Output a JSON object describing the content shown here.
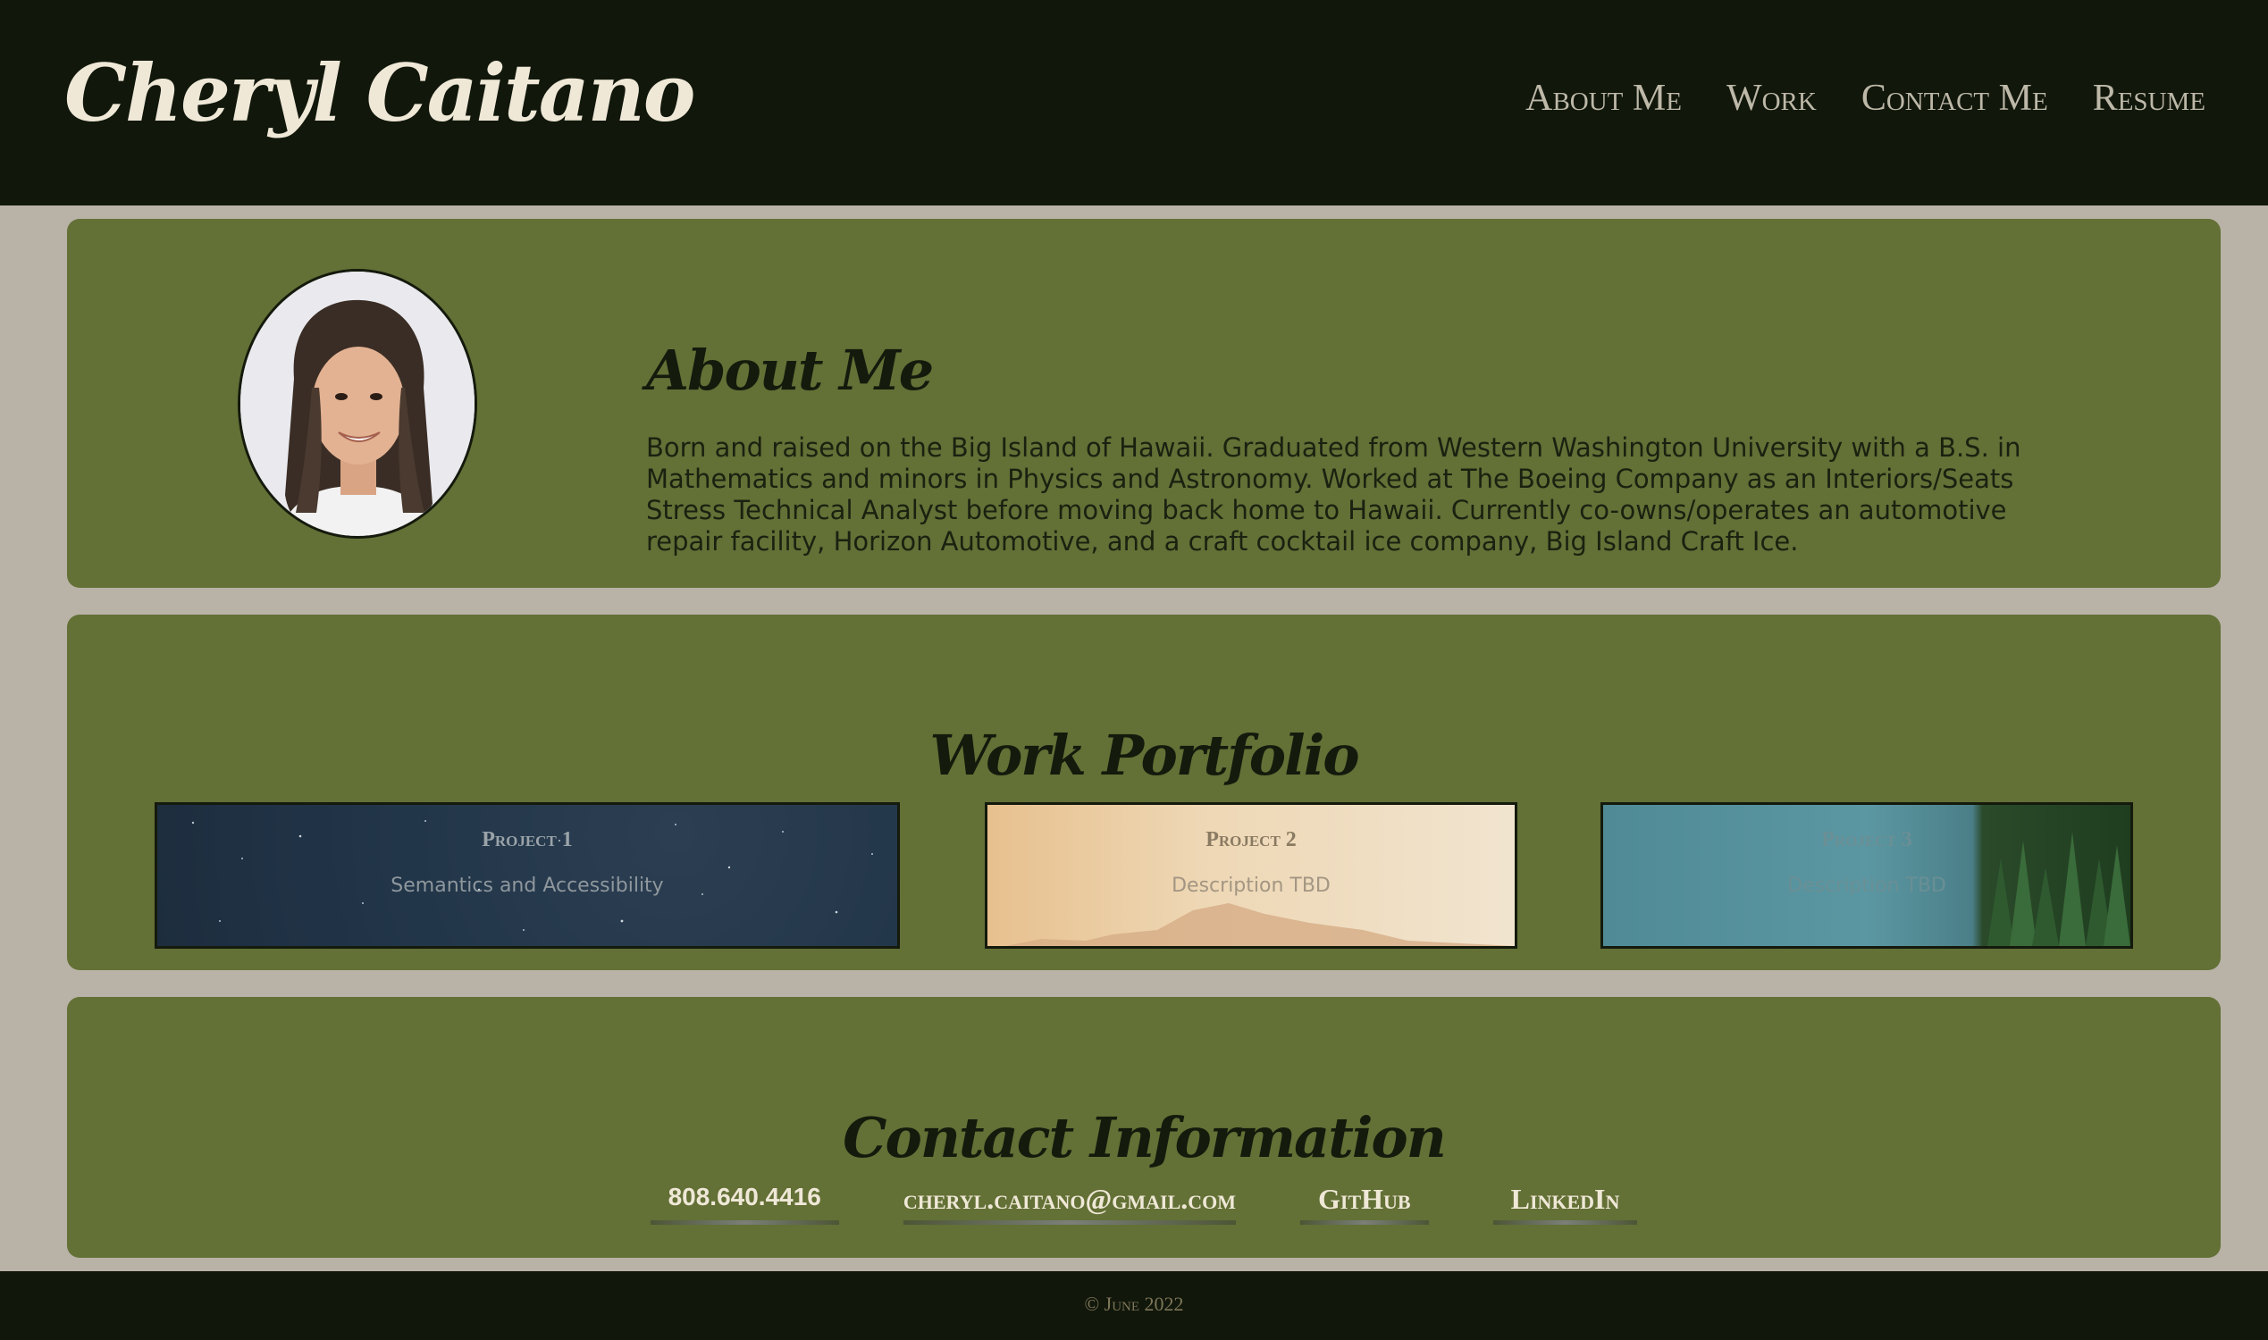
{
  "header": {
    "logo": "Cheryl Caitano",
    "nav": [
      "About Me",
      "Work",
      "Contact Me",
      "Resume"
    ]
  },
  "about": {
    "title": "About Me",
    "text": "Born and raised on the Big Island of Hawaii. Graduated from Western Washington University with a B.S. in Mathematics and minors in Physics and Astronomy. Worked at The Boeing Company as an Interiors/Seats Stress Technical Analyst before moving back home to Hawaii. Currently co-owns/operates an automotive repair facility, Horizon Automotive, and a craft cocktail ice company, Big Island Craft Ice."
  },
  "work": {
    "title": "Work Portfolio",
    "projects": [
      {
        "name": "Project 1",
        "description": "Semantics and Accessibility"
      },
      {
        "name": "Project 2",
        "description": "Description TBD"
      },
      {
        "name": "Project 3",
        "description": "Description TBD"
      }
    ]
  },
  "contact": {
    "title": "Contact Information",
    "phone": "808.640.4416",
    "email": "cheryl.caitano@gmail.com",
    "github": "GitHub",
    "linkedin": "LinkedIn"
  },
  "footer": {
    "text": "© June 2022"
  },
  "colors": {
    "header_bg": "#11170b",
    "page_bg": "#b9b2a6",
    "card_bg": "#637036",
    "heading_text": "#141a0c",
    "light_text": "#efe8d7"
  }
}
